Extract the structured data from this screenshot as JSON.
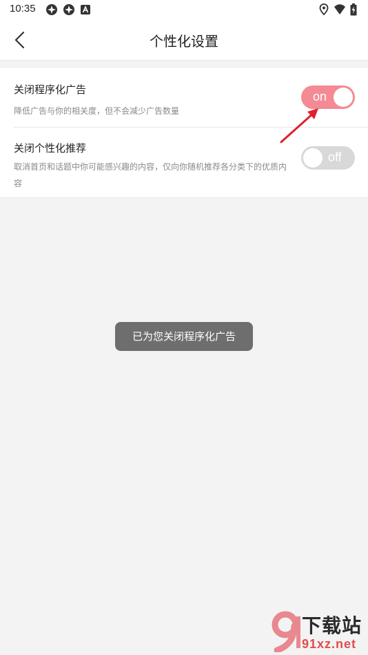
{
  "status_bar": {
    "time": "10:35",
    "left_icons": [
      "notification-app-icon",
      "notification-app-icon",
      "android-a-icon"
    ],
    "right_icons": [
      "location-icon",
      "wifi-icon",
      "battery-charging-icon"
    ]
  },
  "header": {
    "title": "个性化设置",
    "back_icon": "chevron-left-icon"
  },
  "settings": [
    {
      "title": "关闭程序化广告",
      "description": "降低广告与你的相关度，但不会减少广告数量",
      "toggle_label": "on",
      "toggle_state": "on"
    },
    {
      "title": "关闭个性化推荐",
      "description": "取消首页和话题中你可能感兴趣的内容，仅向你随机推荐各分类下的优质内容",
      "toggle_label": "off",
      "toggle_state": "off"
    }
  ],
  "toast": {
    "message": "已为您关闭程序化广告"
  },
  "watermark": {
    "title": "下载站",
    "url": "91xz.net"
  },
  "colors": {
    "toggle_on": "#f48a93",
    "toggle_off": "#d8d8d8",
    "toast_bg": "#6e6e6e",
    "page_bg": "#f3f3f3",
    "annotation_arrow": "#e0202a"
  }
}
